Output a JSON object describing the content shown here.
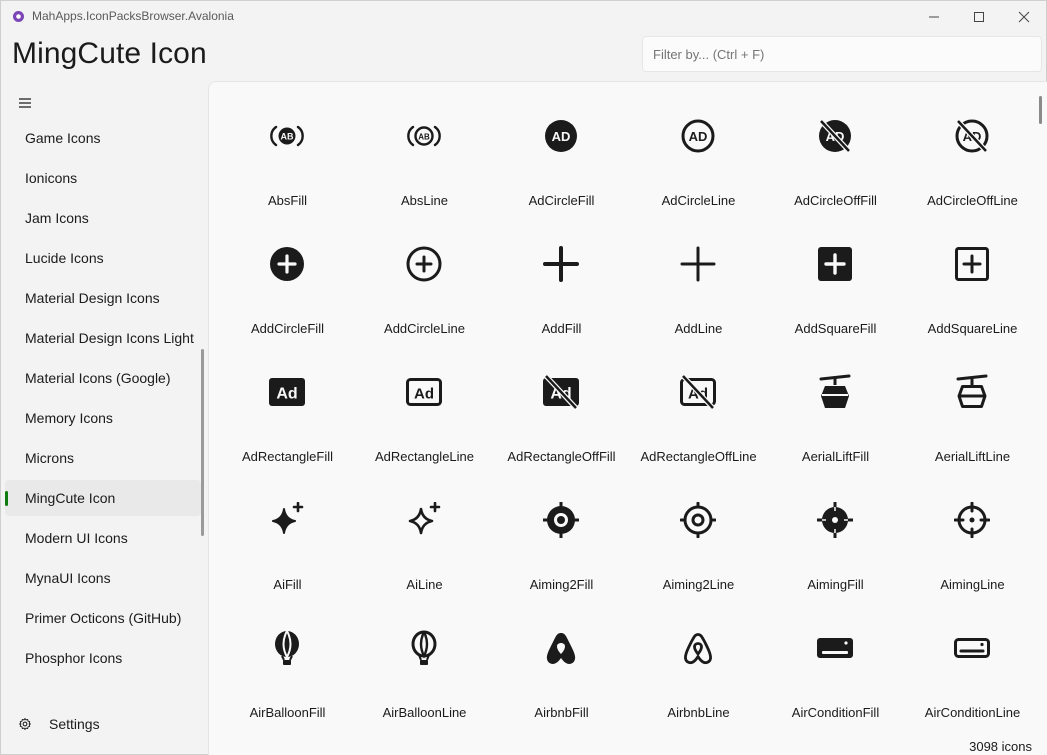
{
  "window": {
    "title": "MahApps.IconPacksBrowser.Avalonia"
  },
  "header": {
    "title": "MingCute Icon"
  },
  "search": {
    "placeholder": "Filter by... (Ctrl + F)"
  },
  "sidebar": {
    "items": [
      {
        "label": "Game Icons"
      },
      {
        "label": "Ionicons"
      },
      {
        "label": "Jam Icons"
      },
      {
        "label": "Lucide Icons"
      },
      {
        "label": "Material Design Icons"
      },
      {
        "label": "Material Design Icons Light"
      },
      {
        "label": "Material Icons (Google)"
      },
      {
        "label": "Memory Icons"
      },
      {
        "label": "Microns"
      },
      {
        "label": "MingCute Icon",
        "selected": true
      },
      {
        "label": "Modern UI Icons"
      },
      {
        "label": "MynaUI Icons"
      },
      {
        "label": "Primer Octicons (GitHub)"
      },
      {
        "label": "Phosphor Icons"
      }
    ],
    "settings_label": "Settings"
  },
  "icons": [
    {
      "name": "AbsFill",
      "icon": "abs-fill-icon"
    },
    {
      "name": "AbsLine",
      "icon": "abs-line-icon"
    },
    {
      "name": "AdCircleFill",
      "icon": "ad-circle-fill-icon"
    },
    {
      "name": "AdCircleLine",
      "icon": "ad-circle-line-icon"
    },
    {
      "name": "AdCircleOffFill",
      "icon": "ad-circle-off-fill-icon"
    },
    {
      "name": "AdCircleOffLine",
      "icon": "ad-circle-off-line-icon"
    },
    {
      "name": "AddCircleFill",
      "icon": "add-circle-fill-icon"
    },
    {
      "name": "AddCircleLine",
      "icon": "add-circle-line-icon"
    },
    {
      "name": "AddFill",
      "icon": "add-fill-icon"
    },
    {
      "name": "AddLine",
      "icon": "add-line-icon"
    },
    {
      "name": "AddSquareFill",
      "icon": "add-square-fill-icon"
    },
    {
      "name": "AddSquareLine",
      "icon": "add-square-line-icon"
    },
    {
      "name": "AdRectangleFill",
      "icon": "ad-rectangle-fill-icon"
    },
    {
      "name": "AdRectangleLine",
      "icon": "ad-rectangle-line-icon"
    },
    {
      "name": "AdRectangleOffFill",
      "icon": "ad-rectangle-off-fill-icon"
    },
    {
      "name": "AdRectangleOffLine",
      "icon": "ad-rectangle-off-line-icon"
    },
    {
      "name": "AerialLiftFill",
      "icon": "aerial-lift-fill-icon"
    },
    {
      "name": "AerialLiftLine",
      "icon": "aerial-lift-line-icon"
    },
    {
      "name": "AiFill",
      "icon": "ai-fill-icon"
    },
    {
      "name": "AiLine",
      "icon": "ai-line-icon"
    },
    {
      "name": "Aiming2Fill",
      "icon": "aiming2-fill-icon"
    },
    {
      "name": "Aiming2Line",
      "icon": "aiming2-line-icon"
    },
    {
      "name": "AimingFill",
      "icon": "aiming-fill-icon"
    },
    {
      "name": "AimingLine",
      "icon": "aiming-line-icon"
    },
    {
      "name": "AirBalloonFill",
      "icon": "air-balloon-fill-icon"
    },
    {
      "name": "AirBalloonLine",
      "icon": "air-balloon-line-icon"
    },
    {
      "name": "AirbnbFill",
      "icon": "airbnb-fill-icon"
    },
    {
      "name": "AirbnbLine",
      "icon": "airbnb-line-icon"
    },
    {
      "name": "AirConditionFill",
      "icon": "air-condition-fill-icon"
    },
    {
      "name": "AirConditionLine",
      "icon": "air-condition-line-icon"
    }
  ],
  "status": {
    "count": "3098 icons"
  },
  "colors": {
    "accent": "#107c10",
    "icon": "#1b1b1b"
  }
}
